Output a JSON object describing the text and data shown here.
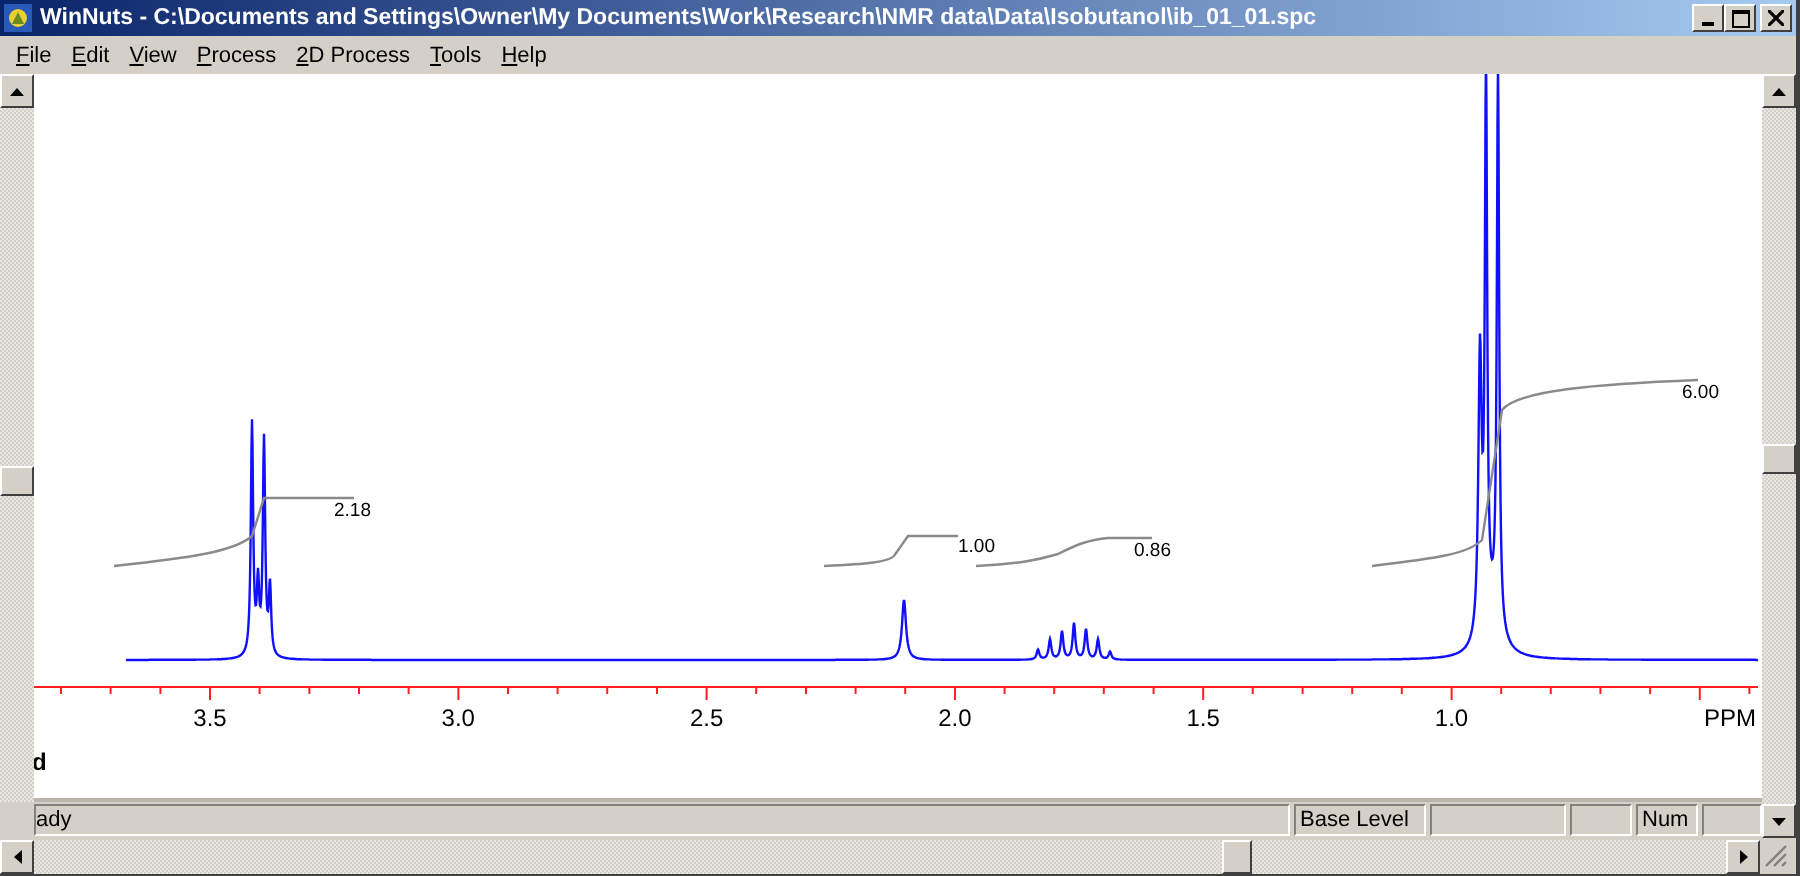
{
  "window": {
    "title": "WinNuts - C:\\Documents and Settings\\Owner\\My Documents\\Work\\Research\\NMR data\\Data\\Isobutanol\\ib_01_01.spc"
  },
  "menu": [
    {
      "label": "File"
    },
    {
      "label": "Edit"
    },
    {
      "label": "View"
    },
    {
      "label": "Process"
    },
    {
      "label": "2D Process"
    },
    {
      "label": "Tools"
    },
    {
      "label": "Help"
    }
  ],
  "spectrum": {
    "axis_labels": [
      "3.5",
      "3.0",
      "2.5",
      "2.0",
      "1.5",
      "1.0"
    ],
    "unit": "PPM",
    "integrals": [
      "2.18",
      "1.00",
      "0.86",
      "6.00"
    ],
    "fragment": "d"
  },
  "status_bar": {
    "message": "ady",
    "panels": [
      "Base Level",
      "Num"
    ]
  }
}
